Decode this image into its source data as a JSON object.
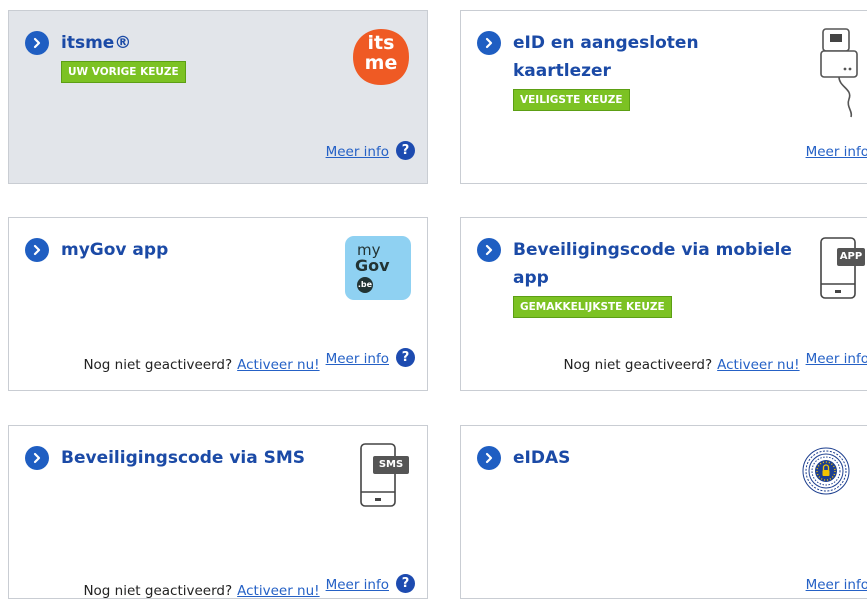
{
  "cards": [
    {
      "title": "itsme®",
      "badge": "UW VORIGE KEUZE",
      "not_activated": "",
      "activate": "",
      "info": "Meer info",
      "logo_text_top": "its",
      "logo_text_bottom": "me"
    },
    {
      "title_line1": "eID en aangesloten",
      "title_line2": "kaartlezer",
      "badge": "VEILIGSTE KEUZE",
      "info": "Meer info"
    },
    {
      "title": "myGov app",
      "not_activated": "Nog niet geactiveerd?",
      "activate": "Activeer nu!",
      "info": "Meer info",
      "logo_my": "my",
      "logo_gov": "Gov",
      "logo_be": ".be"
    },
    {
      "title_line1": "Beveiligingscode via mobiele",
      "title_line2": "app",
      "badge": "GEMAKKELIJKSTE KEUZE",
      "not_activated": "Nog niet geactiveerd?",
      "activate": "Activeer nu!",
      "info": "Meer info",
      "icon_label": "APP"
    },
    {
      "title": "Beveiligingscode via SMS",
      "not_activated": "Nog niet geactiveerd?",
      "activate": "Activeer nu!",
      "info": "Meer info",
      "icon_label": "SMS"
    },
    {
      "title": "eIDAS",
      "info": "Meer info"
    }
  ],
  "help_symbol": "?",
  "colors": {
    "accent": "#1f5ec2",
    "badge": "#7cc223",
    "itsme": "#ef5a24",
    "mygov": "#8fd1f2",
    "selected_bg": "#e2e5ea"
  }
}
